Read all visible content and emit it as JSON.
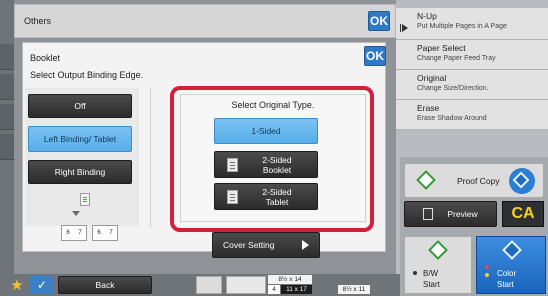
{
  "others": {
    "title": "Others",
    "ok_label": "OK"
  },
  "booklet": {
    "ok_label": "OK",
    "title": "Booklet",
    "subtitle": "Select Output Binding Edge.",
    "binding_options": [
      {
        "label": "Off",
        "selected": false
      },
      {
        "label": "Left Binding/ Tablet",
        "selected": true
      },
      {
        "label": "Right Binding",
        "selected": false
      }
    ],
    "preview_numbers": [
      "6",
      "7",
      "6",
      "7"
    ],
    "original_type": {
      "title": "Select Original Type.",
      "options": [
        {
          "label": "1-Sided",
          "selected": true
        },
        {
          "label": "2-Sided Booklet",
          "selected": false
        },
        {
          "label": "2-Sided Tablet",
          "selected": false
        }
      ]
    },
    "cover_setting_label": "Cover Setting"
  },
  "right_panel": {
    "items": [
      {
        "title": "N-Up",
        "sub": "Put Multiple Pages in A Page"
      },
      {
        "title": "Paper Select",
        "sub": "Change Paper Feed Tray"
      },
      {
        "title": "Original",
        "sub": "Change Size/Direction."
      },
      {
        "title": "Erase",
        "sub": "Erase Shadow Around"
      }
    ],
    "proof_copy_label": "Proof Copy",
    "preview_label": "Preview",
    "ca_label": "CA",
    "bw_start": {
      "line1": "B/W",
      "line2": "Start"
    },
    "color_start": {
      "line1": "Color",
      "line2": "Start"
    }
  },
  "bottom_bar": {
    "back_label": "Back",
    "paper_sizes": [
      "8½ x 14",
      "11 x 17",
      "8½ x 11"
    ],
    "tray_number": "4"
  },
  "colors": {
    "accent_blue": "#56aee9",
    "highlight_red": "#d3203a",
    "ok_blue": "#2f79c6",
    "ca_yellow": "#f5d31e"
  }
}
